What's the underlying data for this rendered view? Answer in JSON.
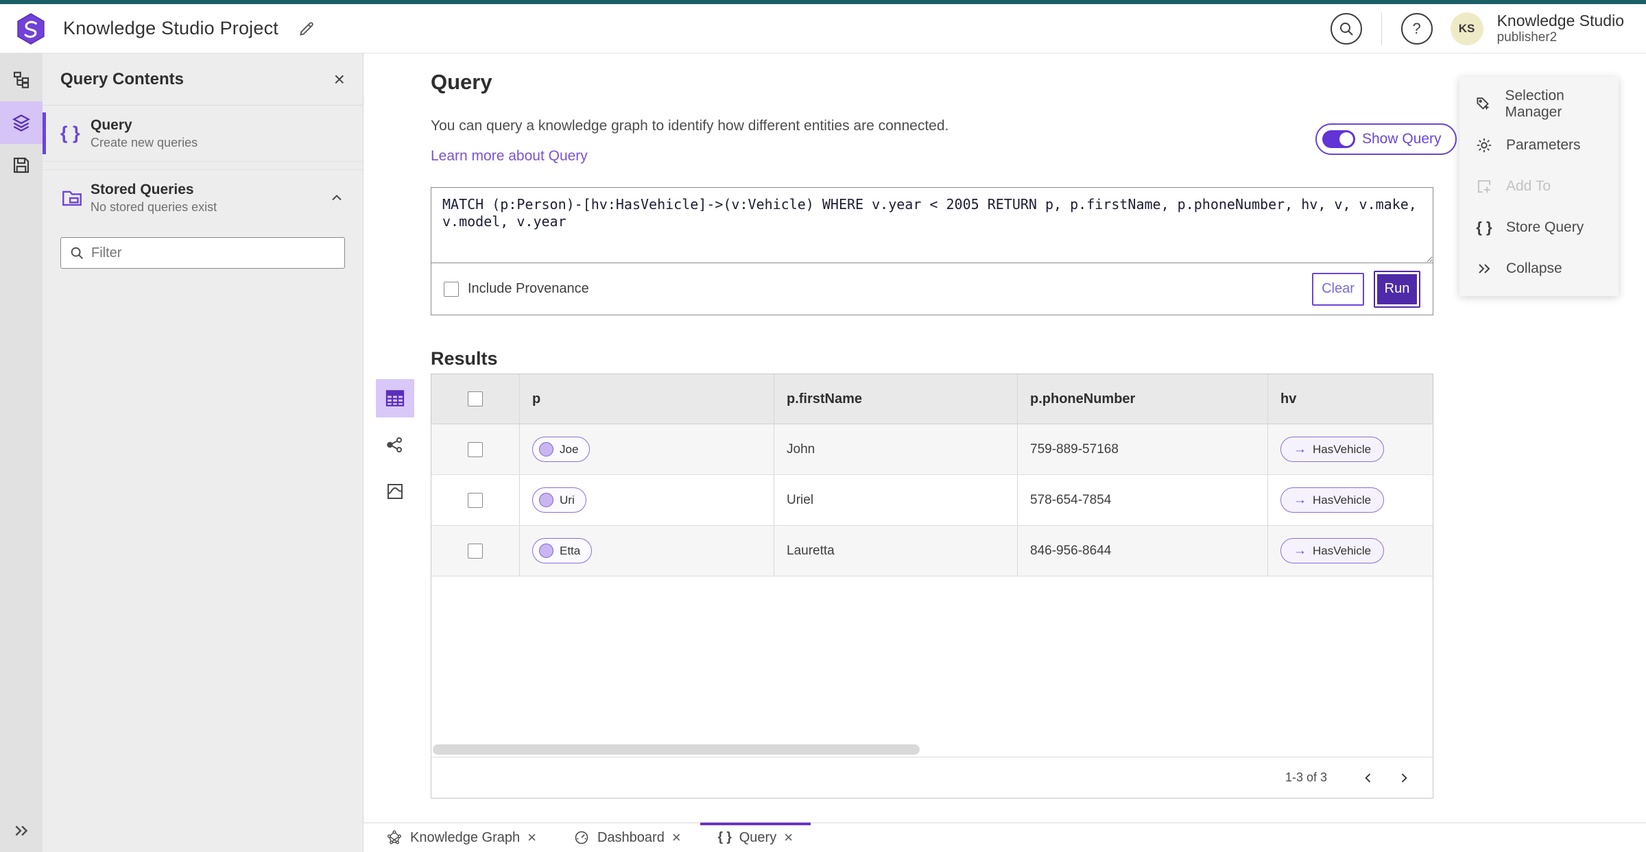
{
  "header": {
    "title": "Knowledge Studio Project",
    "user": {
      "initials": "KS",
      "name": "Knowledge Studio",
      "role": "publisher2"
    }
  },
  "panel": {
    "title": "Query Contents",
    "query_item": {
      "title": "Query",
      "subtitle": "Create new queries"
    },
    "stored_item": {
      "title": "Stored Queries",
      "subtitle": "No stored queries exist"
    },
    "filter_placeholder": "Filter"
  },
  "main": {
    "title": "Query",
    "description": "You can query a knowledge graph to identify how different entities are connected.",
    "learn_more": "Learn more about Query",
    "show_query_label": "Show Query",
    "query_text": "MATCH (p:Person)-[hv:HasVehicle]->(v:Vehicle) WHERE v.year < 2005 RETURN p, p.firstName, p.phoneNumber, hv, v, v.make, v.model, v.year",
    "include_provenance_label": "Include Provenance",
    "clear_label": "Clear",
    "run_label": "Run",
    "results_title": "Results"
  },
  "table": {
    "columns": [
      "p",
      "p.firstName",
      "p.phoneNumber",
      "hv"
    ],
    "rows": [
      {
        "p": "Joe",
        "firstName": "John",
        "phoneNumber": "759-889-57168",
        "hv": "HasVehicle"
      },
      {
        "p": "Uri",
        "firstName": "Uriel",
        "phoneNumber": "578-654-7854",
        "hv": "HasVehicle"
      },
      {
        "p": "Etta",
        "firstName": "Lauretta",
        "phoneNumber": "846-956-8644",
        "hv": "HasVehicle"
      }
    ],
    "pagination": {
      "label": "1-3 of 3"
    }
  },
  "side_menu": {
    "items": [
      {
        "label": "Selection Manager",
        "disabled": false
      },
      {
        "label": "Parameters",
        "disabled": false
      },
      {
        "label": "Add To",
        "disabled": true
      },
      {
        "label": "Store Query",
        "disabled": false
      },
      {
        "label": "Collapse",
        "disabled": false
      }
    ]
  },
  "tabs": [
    {
      "label": "Knowledge Graph",
      "active": false
    },
    {
      "label": "Dashboard",
      "active": false
    },
    {
      "label": "Query",
      "active": true
    }
  ],
  "icons": {
    "braces": "{ }",
    "close": "×",
    "help": "?",
    "arrow_right": "→"
  },
  "colors": {
    "accent_purple": "#6b46d9",
    "run_button_purple": "#4f2aa8",
    "selected_icon_bg": "#d9c8f7",
    "top_strip_teal": "#1a5f66",
    "avatar_yellow": "#efeac6",
    "panel_gray": "#ededed",
    "rail_gray": "#e1e1e1"
  }
}
